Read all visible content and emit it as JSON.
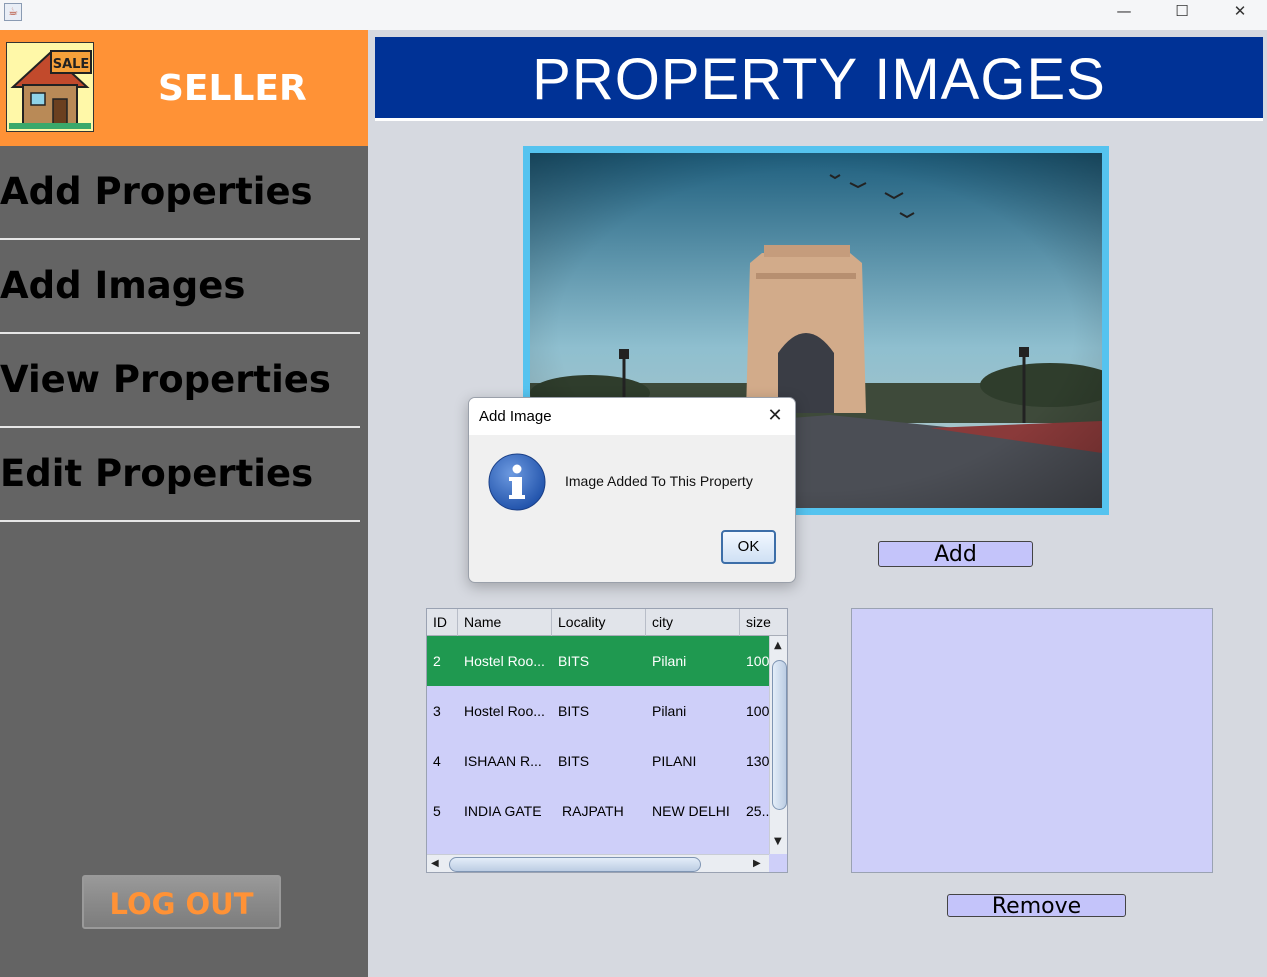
{
  "window": {
    "app_icon": "java-icon",
    "minimize": "—",
    "maximize": "☐",
    "close": "✕"
  },
  "sidebar": {
    "title": "SELLER",
    "logo_label": "SALE",
    "items": [
      {
        "label": "Add Properties"
      },
      {
        "label": "Add Images"
      },
      {
        "label": "View Properties"
      },
      {
        "label": "Edit Properties"
      }
    ],
    "logout_label": "LOG OUT"
  },
  "main": {
    "header": "PROPERTY IMAGES",
    "add_label": "Add",
    "remove_label": "Remove"
  },
  "table": {
    "columns": [
      "ID",
      "Name",
      "Locality",
      "city",
      "size"
    ],
    "rows": [
      {
        "id": "2",
        "name": "Hostel Roo...",
        "locality": "BITS",
        "city": "Pilani",
        "size": "100"
      },
      {
        "id": "3",
        "name": "Hostel Roo...",
        "locality": "BITS",
        "city": "Pilani",
        "size": "100"
      },
      {
        "id": "4",
        "name": "ISHAAN R...",
        "locality": "BITS",
        "city": "PILANI",
        "size": "130"
      },
      {
        "id": "5",
        "name": "INDIA GATE",
        "locality": "RAJPATH",
        "city": "NEW DELHI",
        "size": "25..."
      }
    ],
    "selected_row": 0
  },
  "dialog": {
    "title": "Add Image",
    "message": "Image Added To This Property",
    "ok_label": "OK",
    "close_glyph": "✕"
  },
  "colors": {
    "sidebar_bg": "#646464",
    "seller_header": "#ff9236",
    "main_header": "#003296",
    "selected_row": "#1f9950",
    "list_bg": "#cecff9"
  }
}
